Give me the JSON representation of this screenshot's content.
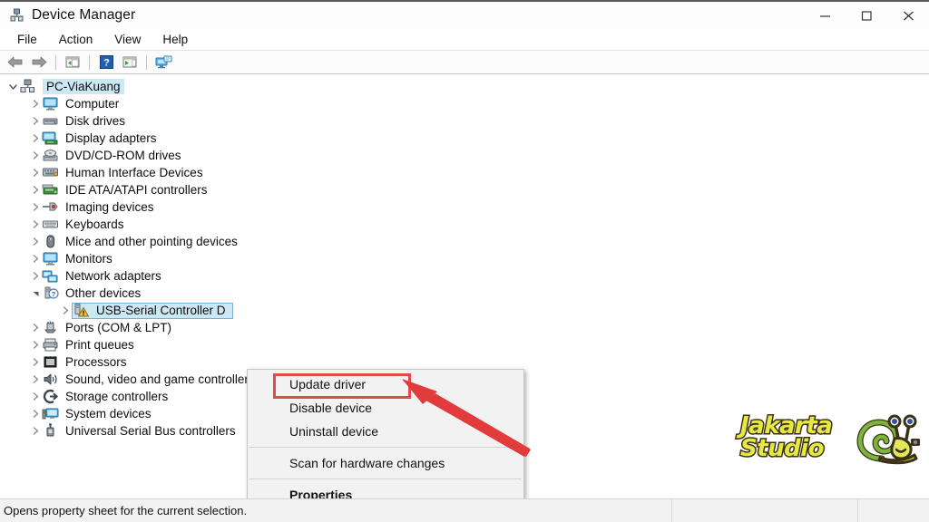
{
  "window": {
    "title": "Device Manager",
    "app_icon": "device-manager-icon",
    "controls": {
      "minimize": "minimize-icon",
      "maximize": "maximize-icon",
      "close": "close-icon"
    }
  },
  "menubar": {
    "items": [
      {
        "label": "File"
      },
      {
        "label": "Action"
      },
      {
        "label": "View"
      },
      {
        "label": "Help"
      }
    ]
  },
  "toolbar": {
    "buttons": [
      {
        "name": "back-arrow-icon",
        "tooltip": "Back"
      },
      {
        "name": "forward-arrow-icon",
        "tooltip": "Forward"
      },
      {
        "name": "show-hide-console-tree-icon",
        "tooltip": "Show/Hide Console Tree"
      },
      {
        "name": "help-icon",
        "tooltip": "Help"
      },
      {
        "name": "properties-icon",
        "tooltip": "Properties"
      },
      {
        "name": "scan-hardware-changes-icon",
        "tooltip": "Scan for hardware changes"
      }
    ]
  },
  "tree": {
    "root": {
      "label": "PC-ViaKuang",
      "icon": "computer-root-icon",
      "expanded": true,
      "selected": false
    },
    "nodes": [
      {
        "label": "Computer",
        "icon": "monitor-icon",
        "level": 1,
        "expanded": false,
        "selected": false
      },
      {
        "label": "Disk drives",
        "icon": "disk-drive-icon",
        "level": 1,
        "expanded": false,
        "selected": false
      },
      {
        "label": "Display adapters",
        "icon": "display-adapter-icon",
        "level": 1,
        "expanded": false,
        "selected": false
      },
      {
        "label": "DVD/CD-ROM drives",
        "icon": "dvd-drive-icon",
        "level": 1,
        "expanded": false,
        "selected": false
      },
      {
        "label": "Human Interface Devices",
        "icon": "hid-icon",
        "level": 1,
        "expanded": false,
        "selected": false
      },
      {
        "label": "IDE ATA/ATAPI controllers",
        "icon": "ide-controller-icon",
        "level": 1,
        "expanded": false,
        "selected": false
      },
      {
        "label": "Imaging devices",
        "icon": "imaging-device-icon",
        "level": 1,
        "expanded": false,
        "selected": false
      },
      {
        "label": "Keyboards",
        "icon": "keyboard-icon",
        "level": 1,
        "expanded": false,
        "selected": false
      },
      {
        "label": "Mice and other pointing devices",
        "icon": "mouse-icon",
        "level": 1,
        "expanded": false,
        "selected": false
      },
      {
        "label": "Monitors",
        "icon": "monitor-icon",
        "level": 1,
        "expanded": false,
        "selected": false
      },
      {
        "label": "Network adapters",
        "icon": "network-adapter-icon",
        "level": 1,
        "expanded": false,
        "selected": false
      },
      {
        "label": "Other devices",
        "icon": "other-devices-icon",
        "level": 1,
        "expanded": true,
        "selected": false
      },
      {
        "label": "USB-Serial Controller D",
        "icon": "unknown-device-warning-icon",
        "level": 2,
        "expanded": false,
        "selected": true
      },
      {
        "label": "Ports (COM & LPT)",
        "icon": "ports-icon",
        "level": 1,
        "expanded": false,
        "selected": false
      },
      {
        "label": "Print queues",
        "icon": "printer-icon",
        "level": 1,
        "expanded": false,
        "selected": false
      },
      {
        "label": "Processors",
        "icon": "processor-icon",
        "level": 1,
        "expanded": false,
        "selected": false
      },
      {
        "label": "Sound, video and game controllers",
        "icon": "sound-icon",
        "level": 1,
        "expanded": false,
        "selected": false
      },
      {
        "label": "Storage controllers",
        "icon": "storage-controller-icon",
        "level": 1,
        "expanded": false,
        "selected": false
      },
      {
        "label": "System devices",
        "icon": "system-device-icon",
        "level": 1,
        "expanded": false,
        "selected": false
      },
      {
        "label": "Universal Serial Bus controllers",
        "icon": "usb-controller-icon",
        "level": 1,
        "expanded": false,
        "selected": false
      }
    ]
  },
  "context_menu": {
    "items": [
      {
        "label": "Update driver",
        "bold": false,
        "highlighted": true
      },
      {
        "label": "Disable device",
        "bold": false,
        "highlighted": false
      },
      {
        "label": "Uninstall device",
        "bold": false,
        "highlighted": false
      },
      {
        "separator": true
      },
      {
        "label": "Scan for hardware changes",
        "bold": false,
        "highlighted": false
      },
      {
        "separator": true
      },
      {
        "label": "Properties",
        "bold": true,
        "highlighted": false
      }
    ]
  },
  "annotations": {
    "highlight_color": "#e24a4a",
    "arrow_color": "#e23b3b",
    "arrow_name": "red-pointer-arrow",
    "highlight_target": "Update driver"
  },
  "watermark": {
    "line1": "Jakarta",
    "line2": "Studio",
    "mascot": "snail-mascot-icon",
    "text_color": "#e7e840",
    "outline_color": "#3b3118"
  },
  "statusbar": {
    "message": "Opens property sheet for the current selection."
  }
}
